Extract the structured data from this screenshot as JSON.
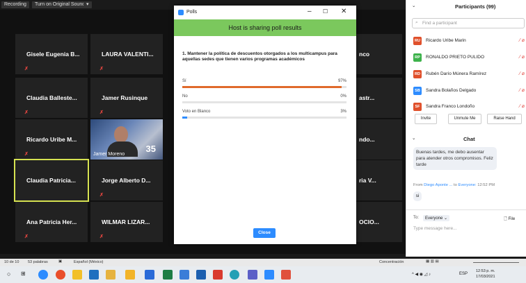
{
  "recbar": {
    "recording": "Recording",
    "original_sound": "Turn on Original Sound"
  },
  "tiles": [
    {
      "name": "Gisele Eugenia B..."
    },
    {
      "name": "LAURA VALENTI..."
    },
    {
      "name": "Claudia Balleste..."
    },
    {
      "name": "Jamer Rusinque"
    },
    {
      "name": "Ricardo Uribe M..."
    },
    {
      "name": "Claudia Patricia..."
    },
    {
      "name": "Jorge Alberto D..."
    },
    {
      "name": "Ana Patricia Her..."
    },
    {
      "name": "WILMAR LIZAR..."
    }
  ],
  "right_tiles": [
    "nco",
    "astr...",
    "ndo...",
    "ria V...",
    "OCIO..."
  ],
  "video": {
    "caption": "Jamer Moreno",
    "number": "35"
  },
  "poll": {
    "window_title": "Polls",
    "banner": "Host is sharing poll results",
    "question": "1. Mantener la política de descuentos otorgados a los multicampus para aquellas sedes que tienen varios programas académicos",
    "options": [
      {
        "label": "Sí",
        "percent_text": "97%",
        "percent": 97
      },
      {
        "label": "No",
        "percent_text": "0%",
        "percent": 0
      },
      {
        "label": "Voto en Blanco",
        "percent_text": "3%",
        "percent": 3
      }
    ],
    "close_label": "Close"
  },
  "participants": {
    "title": "Participants (99)",
    "search_placeholder": "Find a participant",
    "list": [
      {
        "initials": "RU",
        "name": "Ricardo Uribe Marin",
        "color": "#e0502b"
      },
      {
        "initials": "RP",
        "name": "RONALDO PRIETO PULIDO",
        "color": "#3db24b"
      },
      {
        "initials": "RD",
        "name": "Rubén Darío Múnera Ramírez",
        "color": "#e0502b"
      },
      {
        "initials": "SB",
        "name": "Sandra Bolaños Delgado",
        "color": "#2d8cff"
      },
      {
        "initials": "SF",
        "name": "Sandra Franco Londoño",
        "color": "#e0502b"
      }
    ],
    "buttons": {
      "invite": "Invite",
      "unmute": "Unmute Me",
      "raise": "Raise Hand"
    }
  },
  "chat": {
    "title": "Chat",
    "message1": "Buenas tardes, me debo ausentar para atender otros compromisos. Feliz tarde",
    "from_prefix": "From",
    "from_name": "Diego Aponte ...",
    "to_word": "to",
    "to_name": "Everyone:",
    "time": "12:52 PM",
    "message2": "si",
    "to_label": "To:",
    "to_select": "Everyone",
    "file_label": "File",
    "input_placeholder": "Type message here..."
  },
  "statusbar": {
    "page": "10 de 10",
    "words": "53 palabras",
    "lang": "Español (México)",
    "focus": "Concentración"
  },
  "taskbar": {
    "lang": "ESP",
    "time": "12:53 p. m.",
    "date": "17/03/2021"
  }
}
